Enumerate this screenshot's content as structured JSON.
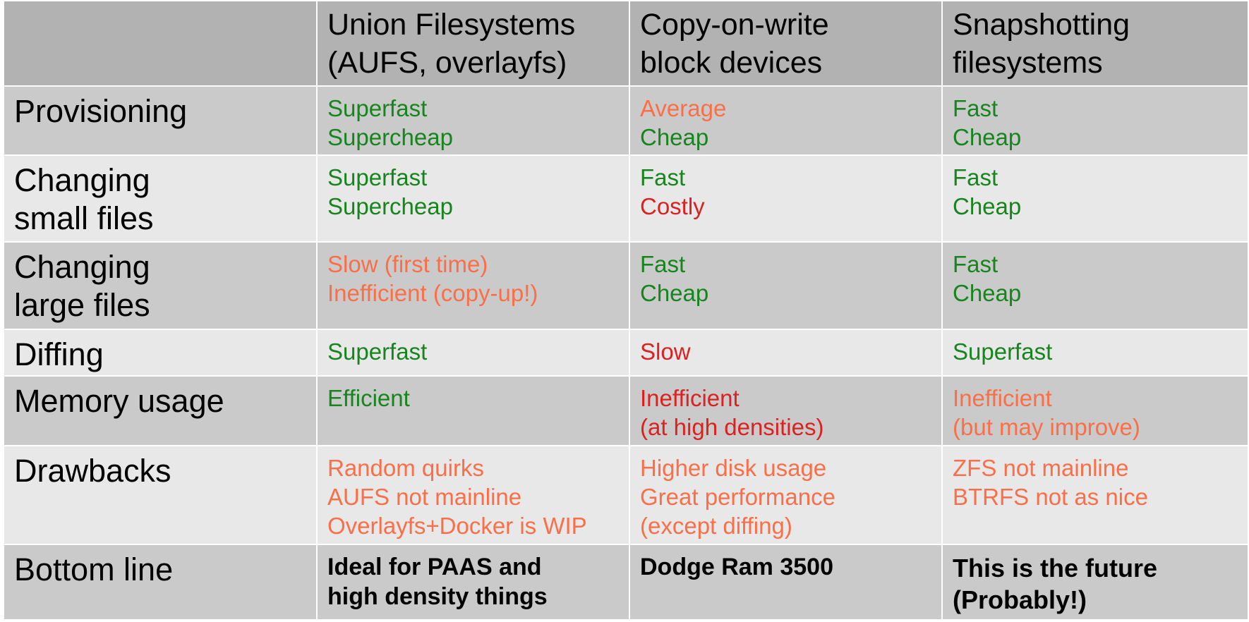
{
  "colors": {
    "good": "#17851d",
    "warn": "#fa6f47",
    "bad": "#dc2121",
    "header_bg": "#b2b2b2",
    "row_dark": "#cacaca",
    "row_light": "#e8e8e8"
  },
  "header": {
    "corner": "",
    "col1": [
      "Union Filesystems",
      "(AUFS, overlayfs)"
    ],
    "col2": [
      "Copy-on-write",
      "block devices"
    ],
    "col3": [
      "Snapshotting",
      "filesystems"
    ]
  },
  "rows": [
    {
      "label": [
        "Provisioning"
      ],
      "cells": [
        [
          {
            "text": "Superfast",
            "tone": "good"
          },
          {
            "text": "Supercheap",
            "tone": "good"
          }
        ],
        [
          {
            "text": "Average",
            "tone": "warn"
          },
          {
            "text": "Cheap",
            "tone": "good"
          }
        ],
        [
          {
            "text": "Fast",
            "tone": "good"
          },
          {
            "text": "Cheap",
            "tone": "good"
          }
        ]
      ]
    },
    {
      "label": [
        "Changing",
        "small files"
      ],
      "cells": [
        [
          {
            "text": "Superfast",
            "tone": "good"
          },
          {
            "text": "Supercheap",
            "tone": "good"
          }
        ],
        [
          {
            "text": "Fast",
            "tone": "good"
          },
          {
            "text": "Costly",
            "tone": "bad"
          }
        ],
        [
          {
            "text": "Fast",
            "tone": "good"
          },
          {
            "text": "Cheap",
            "tone": "good"
          }
        ]
      ]
    },
    {
      "label": [
        "Changing",
        "large files"
      ],
      "cells": [
        [
          {
            "text": "Slow (first time)",
            "tone": "warn"
          },
          {
            "text": "Inefficient (copy-up!)",
            "tone": "warn"
          }
        ],
        [
          {
            "text": "Fast",
            "tone": "good"
          },
          {
            "text": "Cheap",
            "tone": "good"
          }
        ],
        [
          {
            "text": "Fast",
            "tone": "good"
          },
          {
            "text": "Cheap",
            "tone": "good"
          }
        ]
      ]
    },
    {
      "label": [
        "Diffing"
      ],
      "cells": [
        [
          {
            "text": "Superfast",
            "tone": "good"
          }
        ],
        [
          {
            "text": "Slow",
            "tone": "bad"
          }
        ],
        [
          {
            "text": "Superfast",
            "tone": "good"
          }
        ]
      ]
    },
    {
      "label": [
        "Memory usage"
      ],
      "cells": [
        [
          {
            "text": "Efficient",
            "tone": "good"
          }
        ],
        [
          {
            "text": "Inefficient",
            "tone": "bad"
          },
          {
            "text": "(at high densities)",
            "tone": "bad"
          }
        ],
        [
          {
            "text": "Inefficient",
            "tone": "warn"
          },
          {
            "text": "(but may improve)",
            "tone": "warn"
          }
        ]
      ]
    },
    {
      "label": [
        "Drawbacks"
      ],
      "cells": [
        [
          {
            "text": "Random quirks",
            "tone": "warn"
          },
          {
            "text": "AUFS not mainline",
            "tone": "warn"
          },
          {
            "text": "Overlayfs+Docker is WIP",
            "tone": "warn"
          }
        ],
        [
          {
            "text": "Higher disk usage",
            "tone": "warn"
          },
          {
            "text": "Great performance",
            "tone": "warn"
          },
          {
            "text": "(except diffing)",
            "tone": "warn"
          }
        ],
        [
          {
            "text": "ZFS not mainline",
            "tone": "warn"
          },
          {
            "text": "BTRFS not as nice",
            "tone": "warn"
          }
        ]
      ]
    },
    {
      "label": [
        "Bottom line"
      ],
      "cells": [
        [
          {
            "text": "Ideal for PAAS and",
            "tone": "bold"
          },
          {
            "text": "high density things",
            "tone": "bold"
          }
        ],
        [
          {
            "text": "Dodge Ram 3500",
            "tone": "bold"
          }
        ],
        [
          {
            "text": "This is the future",
            "tone": "bold"
          },
          {
            "text": "(Probably!)",
            "tone": "bold"
          }
        ]
      ]
    }
  ]
}
